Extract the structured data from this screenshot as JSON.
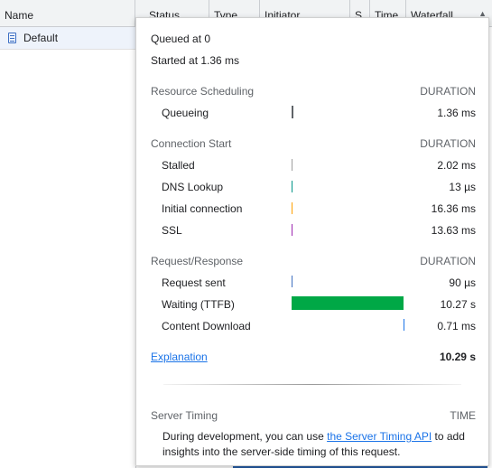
{
  "table": {
    "columns": [
      "Name",
      "Status",
      "Type",
      "Initiator",
      "S.",
      "Time",
      "Waterfall"
    ],
    "rows": [
      {
        "name": "Default"
      }
    ]
  },
  "timing": {
    "queued_at": "Queued at 0",
    "started_at": "Started at 1.36 ms",
    "sections": [
      {
        "title": "Resource Scheduling",
        "col": "DURATION",
        "rows": [
          {
            "label": "Queueing",
            "value": "1.36 ms",
            "color": "#5f6368"
          }
        ]
      },
      {
        "title": "Connection Start",
        "col": "DURATION",
        "rows": [
          {
            "label": "Stalled",
            "value": "2.02 ms",
            "color": "#9e9e9e"
          },
          {
            "label": "DNS Lookup",
            "value": "13 µs",
            "color": "#009688"
          },
          {
            "label": "Initial connection",
            "value": "16.36 ms",
            "color": "#ffa000"
          },
          {
            "label": "SSL",
            "value": "13.63 ms",
            "color": "#9c27b0"
          }
        ]
      },
      {
        "title": "Request/Response",
        "col": "DURATION",
        "rows": [
          {
            "label": "Request sent",
            "value": "90 µs",
            "color": "#3f6fc0"
          },
          {
            "label": "Waiting (TTFB)",
            "value": "10.27 s",
            "color": "#00a846"
          },
          {
            "label": "Content Download",
            "value": "0.71 ms",
            "color": "#1a73e8"
          }
        ]
      }
    ],
    "explanation_link": "Explanation",
    "total": "10.29 s"
  },
  "server_timing": {
    "title": "Server Timing",
    "col": "TIME",
    "note_before": "During development, you can use ",
    "note_link": "the Server Timing API",
    "note_after": " to add insights into the server-side timing of this request."
  }
}
